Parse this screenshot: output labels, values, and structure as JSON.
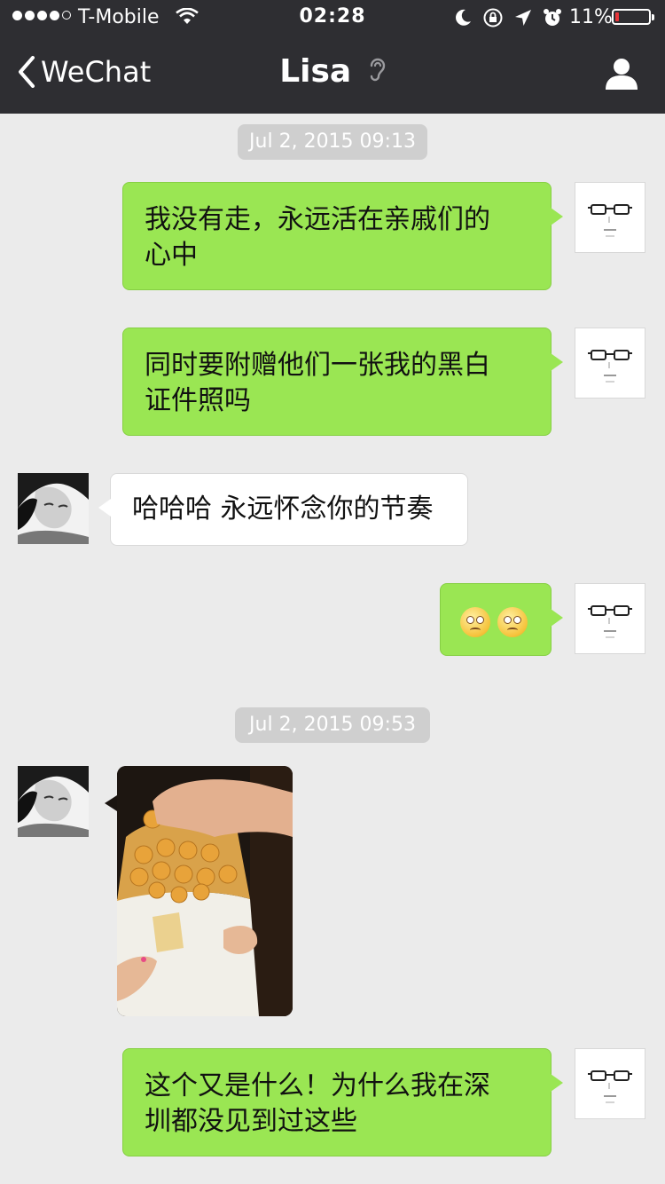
{
  "status_bar": {
    "carrier": "T-Mobile",
    "time": "02:28",
    "battery_percent_text": "11%",
    "battery_level": 0.11,
    "signal_bars_filled": 4,
    "signal_bars_total": 5
  },
  "nav": {
    "back_label": "WeChat",
    "title": "Lisa"
  },
  "colors": {
    "nav_bg": "#2e2e32",
    "chat_bg": "#ebebeb",
    "outgoing_bubble": "#9ae653",
    "incoming_bubble": "#ffffff",
    "timestamp_bg": "#cfcfcf",
    "battery_low": "#e8363b"
  },
  "messages": {
    "ts1": "Jul 2, 2015 09:13",
    "m1_line1": "我没有走，永远活在亲戚们的",
    "m1_line2": "心中",
    "m2_line1": "同时要附赠他们一张我的黑白",
    "m2_line2": "证件照吗",
    "m3": "哈哈哈 永远怀念你的节奏",
    "m4_emoji": "flushed-emoji x2",
    "ts2": "Jul 2, 2015 09:53",
    "m5_image": "photo-egg-waffle",
    "m6_line1": "这个又是什么！为什么我在深",
    "m6_line2": "圳都没见到过这些"
  }
}
